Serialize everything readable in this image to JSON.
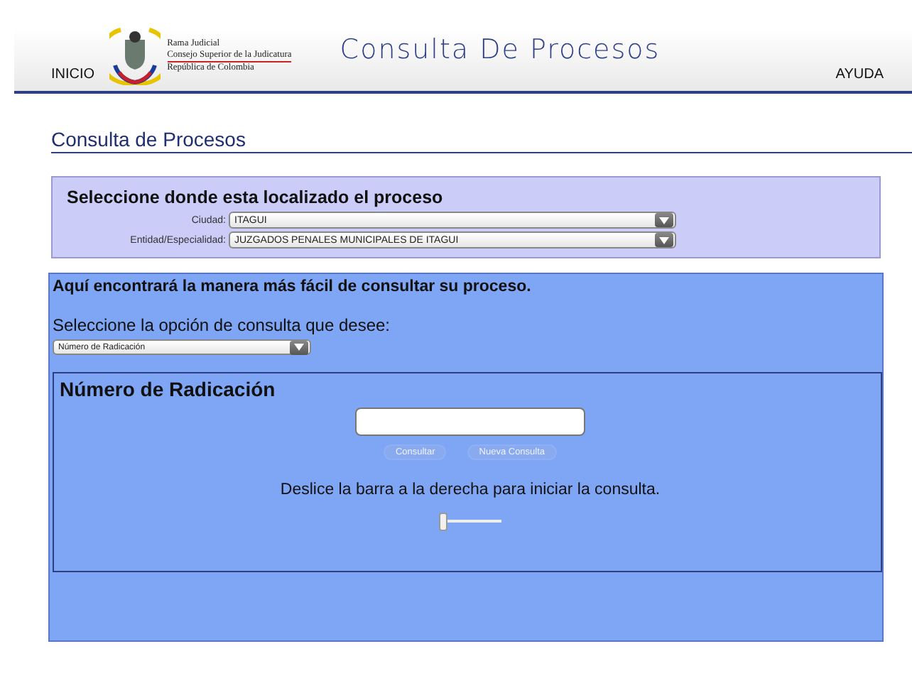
{
  "header": {
    "nav_left": "INICIO",
    "logo_lines": [
      "Rama Judicial",
      "Consejo Superior de la Judicatura",
      "República de Colombia"
    ],
    "title": "Consulta De Procesos",
    "nav_right": "AYUDA"
  },
  "page_title": "Consulta de Procesos",
  "location": {
    "heading": "Seleccione donde esta localizado el proceso",
    "fields": [
      {
        "label": "Ciudad:",
        "value": "ITAGUI"
      },
      {
        "label": "Entidad/Especialidad:",
        "value": "JUZGADOS PENALES MUNICIPALES DE ITAGUI"
      }
    ]
  },
  "query": {
    "intro": "Aquí encontrará la manera más fácil de consultar su proceso.",
    "option_label": "Seleccione la opción de consulta que desee:",
    "option_value": "Número de Radicación",
    "section_title": "Número de Radicación",
    "buttons": [
      {
        "label": "Consultar",
        "disabled": true
      },
      {
        "label": "Nueva Consulta",
        "disabled": true
      }
    ],
    "slider_hint": "Deslice la barra a la derecha para iniciar la consulta.",
    "slider": {
      "level": 0
    }
  }
}
